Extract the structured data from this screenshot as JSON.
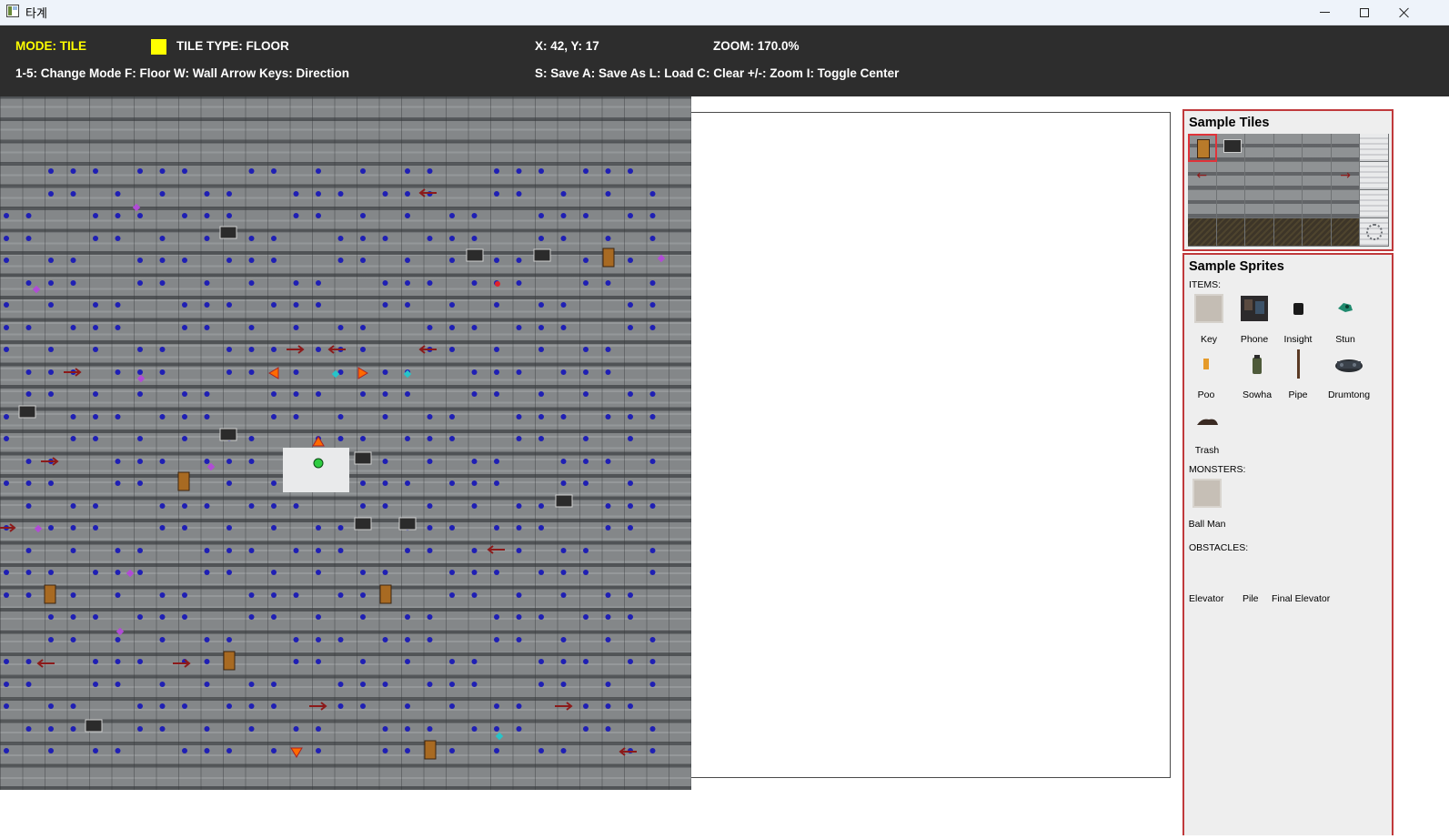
{
  "window": {
    "title": "타계",
    "controls": [
      "minimize-icon",
      "maximize-icon",
      "close-icon"
    ]
  },
  "status": {
    "mode": "MODE: TILE",
    "tile_type": "TILE TYPE: FLOOR",
    "swatch_color": "#ffff00",
    "coords": "X: 42, Y: 17",
    "zoom": "ZOOM: 170.0%",
    "help_left": "1-5: Change Mode  F: Floor  W: Wall  Arrow Keys: Direction",
    "help_right": "S: Save  A: Save As  L: Load  C: Clear  +/-: Zoom  I: Toggle Center"
  },
  "map": {
    "background_color": "#848789",
    "marker_colors": {
      "path_dot": "#1f1fb4",
      "item": "#b04cd6",
      "player": "#2ecc40",
      "arrow": "#8c1a1a",
      "spawn": "#ff6a00",
      "cyan": "#27c4c9",
      "red_dot": "#e0222a"
    }
  },
  "tiles_panel": {
    "title": "Sample Tiles",
    "tiles": [
      "door",
      "machine",
      "floor",
      "rubble",
      "floor",
      "graffiti",
      "white-wall",
      "arrow-left",
      "floor",
      "rubble",
      "floor",
      "floor",
      "arrow-right",
      "white-wall",
      "floor",
      "floor",
      "floor",
      "floor",
      "floor",
      "floor",
      "white-wall",
      "dark",
      "dark",
      "dark",
      "dark",
      "dark",
      "dark",
      "fan"
    ],
    "selected_index": 0
  },
  "sprites_panel": {
    "title": "Sample Sprites",
    "items_label": "ITEMS:",
    "items": [
      {
        "label": "Key"
      },
      {
        "label": "Phone"
      },
      {
        "label": "Insight"
      },
      {
        "label": "Stun"
      },
      {
        "label": "Poo"
      },
      {
        "label": "Sowha"
      },
      {
        "label": "Pipe"
      },
      {
        "label": "Drumtong"
      },
      {
        "label": "Trash"
      }
    ],
    "monsters_label": "MONSTERS:",
    "monsters": [
      {
        "label": "Ball Man"
      }
    ],
    "obstacles_label": "OBSTACLES:",
    "obstacles": [
      {
        "label": "Elevator"
      },
      {
        "label": "Pile"
      },
      {
        "label": "Final Elevator"
      }
    ]
  }
}
